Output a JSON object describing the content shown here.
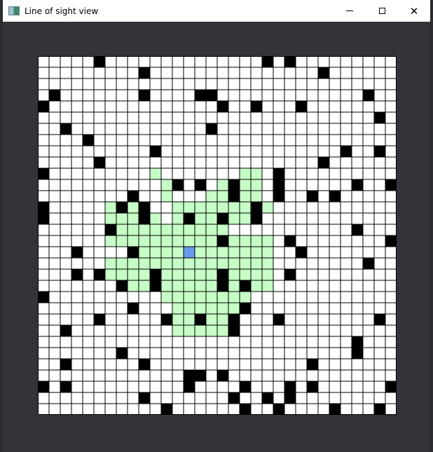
{
  "window": {
    "title": "Line of sight view",
    "icon": "app-window-icon",
    "controls": [
      "minimize-icon",
      "maximize-icon",
      "close-icon"
    ]
  },
  "grid": {
    "size": 32,
    "colors": {
      "empty": "#ffffff",
      "wall": "#000000",
      "visible": "#c6ffc6",
      "viewer": "#6699ee",
      "line": "#000000"
    },
    "viewer": [
      13,
      17
    ],
    "walls": [
      [
        5,
        0
      ],
      [
        20,
        0
      ],
      [
        22,
        0
      ],
      [
        9,
        1
      ],
      [
        25,
        1
      ],
      [
        1,
        3
      ],
      [
        9,
        3
      ],
      [
        14,
        3
      ],
      [
        15,
        3
      ],
      [
        29,
        3
      ],
      [
        0,
        4
      ],
      [
        16,
        4
      ],
      [
        19,
        4
      ],
      [
        23,
        4
      ],
      [
        30,
        5
      ],
      [
        2,
        6
      ],
      [
        15,
        6
      ],
      [
        4,
        7
      ],
      [
        10,
        8
      ],
      [
        27,
        8
      ],
      [
        30,
        8
      ],
      [
        5,
        9
      ],
      [
        25,
        9
      ],
      [
        0,
        10
      ],
      [
        21,
        10
      ],
      [
        12,
        11
      ],
      [
        14,
        11
      ],
      [
        17,
        11
      ],
      [
        21,
        11
      ],
      [
        28,
        11
      ],
      [
        31,
        11
      ],
      [
        8,
        12
      ],
      [
        17,
        12
      ],
      [
        21,
        12
      ],
      [
        24,
        12
      ],
      [
        26,
        12
      ],
      [
        0,
        13
      ],
      [
        7,
        13
      ],
      [
        9,
        13
      ],
      [
        19,
        13
      ],
      [
        0,
        14
      ],
      [
        9,
        14
      ],
      [
        13,
        14
      ],
      [
        16,
        14
      ],
      [
        19,
        14
      ],
      [
        6,
        15
      ],
      [
        28,
        15
      ],
      [
        16,
        16
      ],
      [
        22,
        16
      ],
      [
        31,
        16
      ],
      [
        3,
        17
      ],
      [
        8,
        17
      ],
      [
        23,
        17
      ],
      [
        29,
        18
      ],
      [
        3,
        19
      ],
      [
        5,
        19
      ],
      [
        10,
        19
      ],
      [
        16,
        19
      ],
      [
        22,
        19
      ],
      [
        7,
        20
      ],
      [
        10,
        20
      ],
      [
        16,
        20
      ],
      [
        18,
        20
      ],
      [
        0,
        21
      ],
      [
        8,
        22
      ],
      [
        18,
        22
      ],
      [
        5,
        23
      ],
      [
        11,
        23
      ],
      [
        14,
        23
      ],
      [
        17,
        23
      ],
      [
        21,
        23
      ],
      [
        30,
        23
      ],
      [
        2,
        24
      ],
      [
        17,
        24
      ],
      [
        28,
        25
      ],
      [
        7,
        26
      ],
      [
        28,
        26
      ],
      [
        2,
        27
      ],
      [
        9,
        27
      ],
      [
        24,
        27
      ],
      [
        13,
        28
      ],
      [
        14,
        28
      ],
      [
        16,
        28
      ],
      [
        0,
        29
      ],
      [
        2,
        29
      ],
      [
        13,
        29
      ],
      [
        18,
        29
      ],
      [
        22,
        29
      ],
      [
        24,
        29
      ],
      [
        31,
        29
      ],
      [
        9,
        30
      ],
      [
        17,
        30
      ],
      [
        20,
        30
      ],
      [
        22,
        30
      ],
      [
        11,
        31
      ],
      [
        18,
        31
      ],
      [
        21,
        31
      ],
      [
        26,
        31
      ],
      [
        30,
        31
      ]
    ],
    "visible": [
      [
        10,
        10
      ],
      [
        18,
        10
      ],
      [
        19,
        10
      ],
      [
        11,
        11
      ],
      [
        16,
        11
      ],
      [
        18,
        11
      ],
      [
        19,
        11
      ],
      [
        11,
        12
      ],
      [
        15,
        12
      ],
      [
        16,
        12
      ],
      [
        18,
        12
      ],
      [
        19,
        12
      ],
      [
        6,
        13
      ],
      [
        8,
        13
      ],
      [
        12,
        13
      ],
      [
        13,
        13
      ],
      [
        14,
        13
      ],
      [
        15,
        13
      ],
      [
        16,
        13
      ],
      [
        17,
        13
      ],
      [
        18,
        13
      ],
      [
        20,
        13
      ],
      [
        6,
        14
      ],
      [
        7,
        14
      ],
      [
        8,
        14
      ],
      [
        10,
        14
      ],
      [
        12,
        14
      ],
      [
        14,
        14
      ],
      [
        15,
        14
      ],
      [
        17,
        14
      ],
      [
        18,
        14
      ],
      [
        7,
        15
      ],
      [
        8,
        15
      ],
      [
        9,
        15
      ],
      [
        10,
        15
      ],
      [
        11,
        15
      ],
      [
        12,
        15
      ],
      [
        13,
        15
      ],
      [
        14,
        15
      ],
      [
        15,
        15
      ],
      [
        16,
        15
      ],
      [
        6,
        16
      ],
      [
        7,
        16
      ],
      [
        8,
        16
      ],
      [
        9,
        16
      ],
      [
        10,
        16
      ],
      [
        11,
        16
      ],
      [
        12,
        16
      ],
      [
        13,
        16
      ],
      [
        14,
        16
      ],
      [
        15,
        16
      ],
      [
        17,
        16
      ],
      [
        18,
        16
      ],
      [
        19,
        16
      ],
      [
        20,
        16
      ],
      [
        9,
        17
      ],
      [
        10,
        17
      ],
      [
        11,
        17
      ],
      [
        12,
        17
      ],
      [
        14,
        17
      ],
      [
        15,
        17
      ],
      [
        16,
        17
      ],
      [
        17,
        17
      ],
      [
        18,
        17
      ],
      [
        19,
        17
      ],
      [
        20,
        17
      ],
      [
        6,
        18
      ],
      [
        7,
        18
      ],
      [
        8,
        18
      ],
      [
        9,
        18
      ],
      [
        10,
        18
      ],
      [
        11,
        18
      ],
      [
        12,
        18
      ],
      [
        13,
        18
      ],
      [
        14,
        18
      ],
      [
        15,
        18
      ],
      [
        16,
        18
      ],
      [
        17,
        18
      ],
      [
        18,
        18
      ],
      [
        19,
        18
      ],
      [
        20,
        18
      ],
      [
        6,
        19
      ],
      [
        7,
        19
      ],
      [
        8,
        19
      ],
      [
        9,
        19
      ],
      [
        11,
        19
      ],
      [
        12,
        19
      ],
      [
        13,
        19
      ],
      [
        14,
        19
      ],
      [
        15,
        19
      ],
      [
        17,
        19
      ],
      [
        18,
        19
      ],
      [
        19,
        19
      ],
      [
        20,
        19
      ],
      [
        8,
        20
      ],
      [
        9,
        20
      ],
      [
        11,
        20
      ],
      [
        12,
        20
      ],
      [
        13,
        20
      ],
      [
        14,
        20
      ],
      [
        15,
        20
      ],
      [
        17,
        20
      ],
      [
        19,
        20
      ],
      [
        20,
        20
      ],
      [
        11,
        21
      ],
      [
        12,
        21
      ],
      [
        13,
        21
      ],
      [
        14,
        21
      ],
      [
        15,
        21
      ],
      [
        16,
        21
      ],
      [
        17,
        21
      ],
      [
        18,
        21
      ],
      [
        12,
        22
      ],
      [
        13,
        22
      ],
      [
        14,
        22
      ],
      [
        15,
        22
      ],
      [
        16,
        22
      ],
      [
        17,
        22
      ],
      [
        12,
        23
      ],
      [
        13,
        23
      ],
      [
        15,
        23
      ],
      [
        16,
        23
      ],
      [
        12,
        24
      ],
      [
        13,
        24
      ],
      [
        14,
        24
      ],
      [
        15,
        24
      ],
      [
        16,
        24
      ]
    ]
  }
}
